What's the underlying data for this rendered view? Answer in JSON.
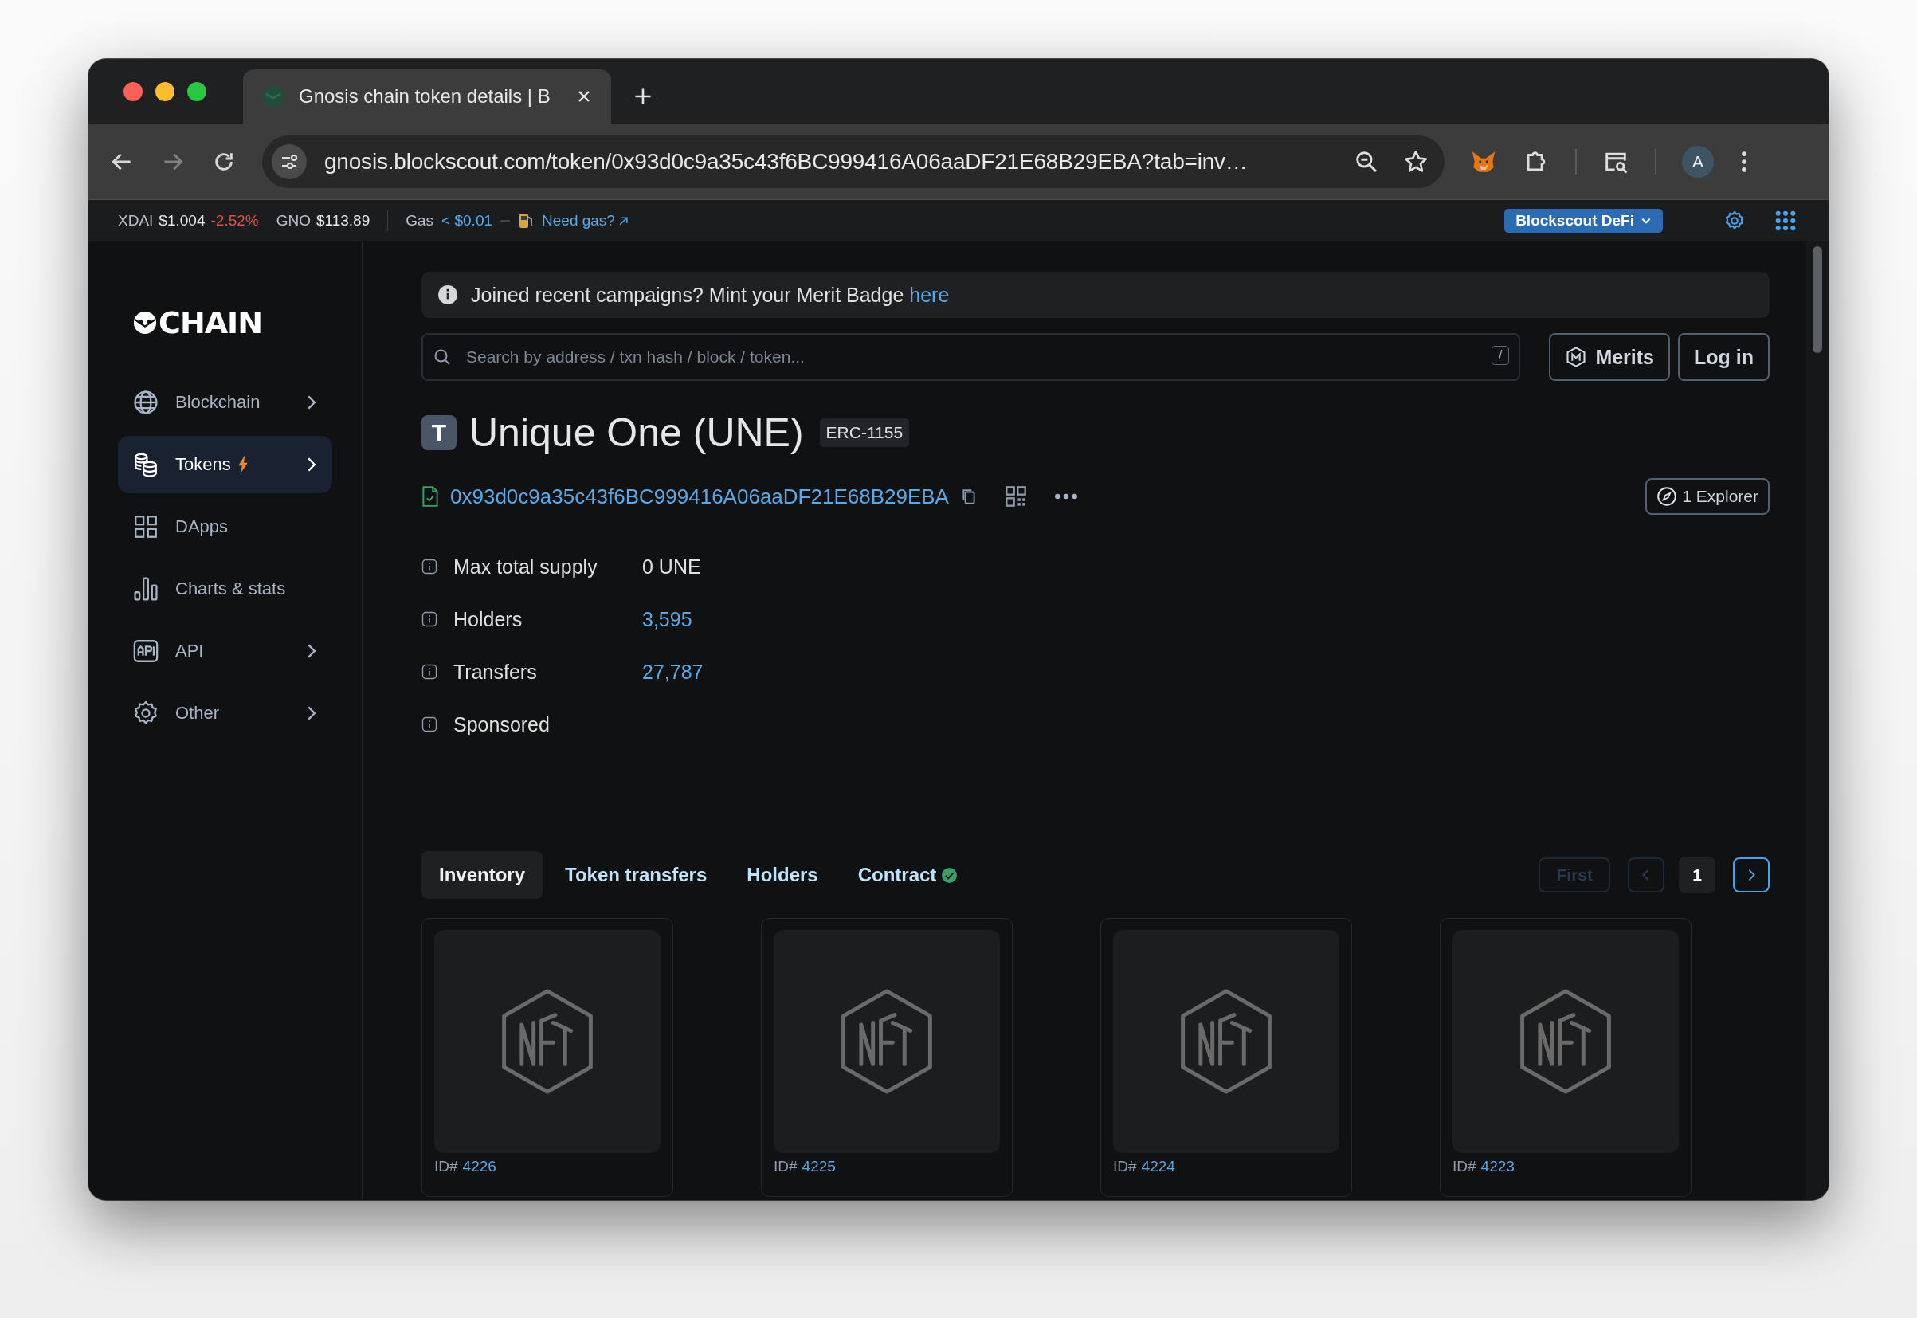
{
  "browser": {
    "tab_title": "Gnosis chain token details | B",
    "url": "gnosis.blockscout.com/token/0x93d0c9a35c43f6BC999416A06aaDF21E68B29EBA?tab=inv…",
    "avatar": "A"
  },
  "stats_bar": {
    "prices": [
      {
        "label": "XDAI",
        "value": "$1.004",
        "change": "-2.52%"
      },
      {
        "label": "GNO",
        "value": "$113.89"
      }
    ],
    "gas_label": "Gas",
    "gas_value": "< $0.01",
    "need_gas": "Need gas?",
    "network_button": "Blockscout DeFi"
  },
  "sidebar": {
    "logo": "CHAIN",
    "items": [
      {
        "label": "Blockchain",
        "kind": "globe",
        "selected": false,
        "expandable": true,
        "hot": false
      },
      {
        "label": "Tokens",
        "kind": "coins",
        "selected": true,
        "expandable": true,
        "hot": true
      },
      {
        "label": "DApps",
        "kind": "grid",
        "selected": false,
        "expandable": false,
        "hot": false
      },
      {
        "label": "Charts & stats",
        "kind": "chart",
        "selected": false,
        "expandable": false,
        "hot": false
      },
      {
        "label": "API",
        "kind": "api",
        "selected": false,
        "expandable": true,
        "hot": false
      },
      {
        "label": "Other",
        "kind": "gear",
        "selected": false,
        "expandable": true,
        "hot": false
      }
    ]
  },
  "banner": {
    "text": "Joined recent campaigns? Mint your Merit Badge",
    "link": "here"
  },
  "search": {
    "placeholder": "Search by address / txn hash / block / token...",
    "shortcut": "/"
  },
  "header_buttons": [
    {
      "label": "Merits",
      "kind": "merits"
    },
    {
      "label": "Log in",
      "kind": "plain"
    }
  ],
  "token": {
    "avatar_letter": "T",
    "name": "Unique One (UNE)",
    "standard": "ERC-1155",
    "address": "0x93d0c9a35c43f6BC999416A06aaDF21E68B29EBA",
    "verified": true,
    "explorer_button": "1 Explorer"
  },
  "details": [
    {
      "label": "Max total supply",
      "value": "0 UNE",
      "link": false
    },
    {
      "label": "Holders",
      "value": "3,595",
      "link": true
    },
    {
      "label": "Transfers",
      "value": "27,787",
      "link": true
    },
    {
      "label": "Sponsored"
    }
  ],
  "tabs": [
    {
      "label": "Inventory",
      "selected": true,
      "verified": false
    },
    {
      "label": "Token transfers",
      "selected": false,
      "verified": false
    },
    {
      "label": "Holders",
      "selected": false,
      "verified": false
    },
    {
      "label": "Contract",
      "selected": false,
      "verified": true
    }
  ],
  "pagination": {
    "first": "First",
    "first_disabled": true,
    "prev_disabled": true,
    "page": "1"
  },
  "inventory": [
    {
      "id_label": "ID#",
      "id": "4226"
    },
    {
      "id_label": "ID#",
      "id": "4225"
    },
    {
      "id_label": "ID#",
      "id": "4224"
    },
    {
      "id_label": "ID#",
      "id": "4223"
    }
  ]
}
